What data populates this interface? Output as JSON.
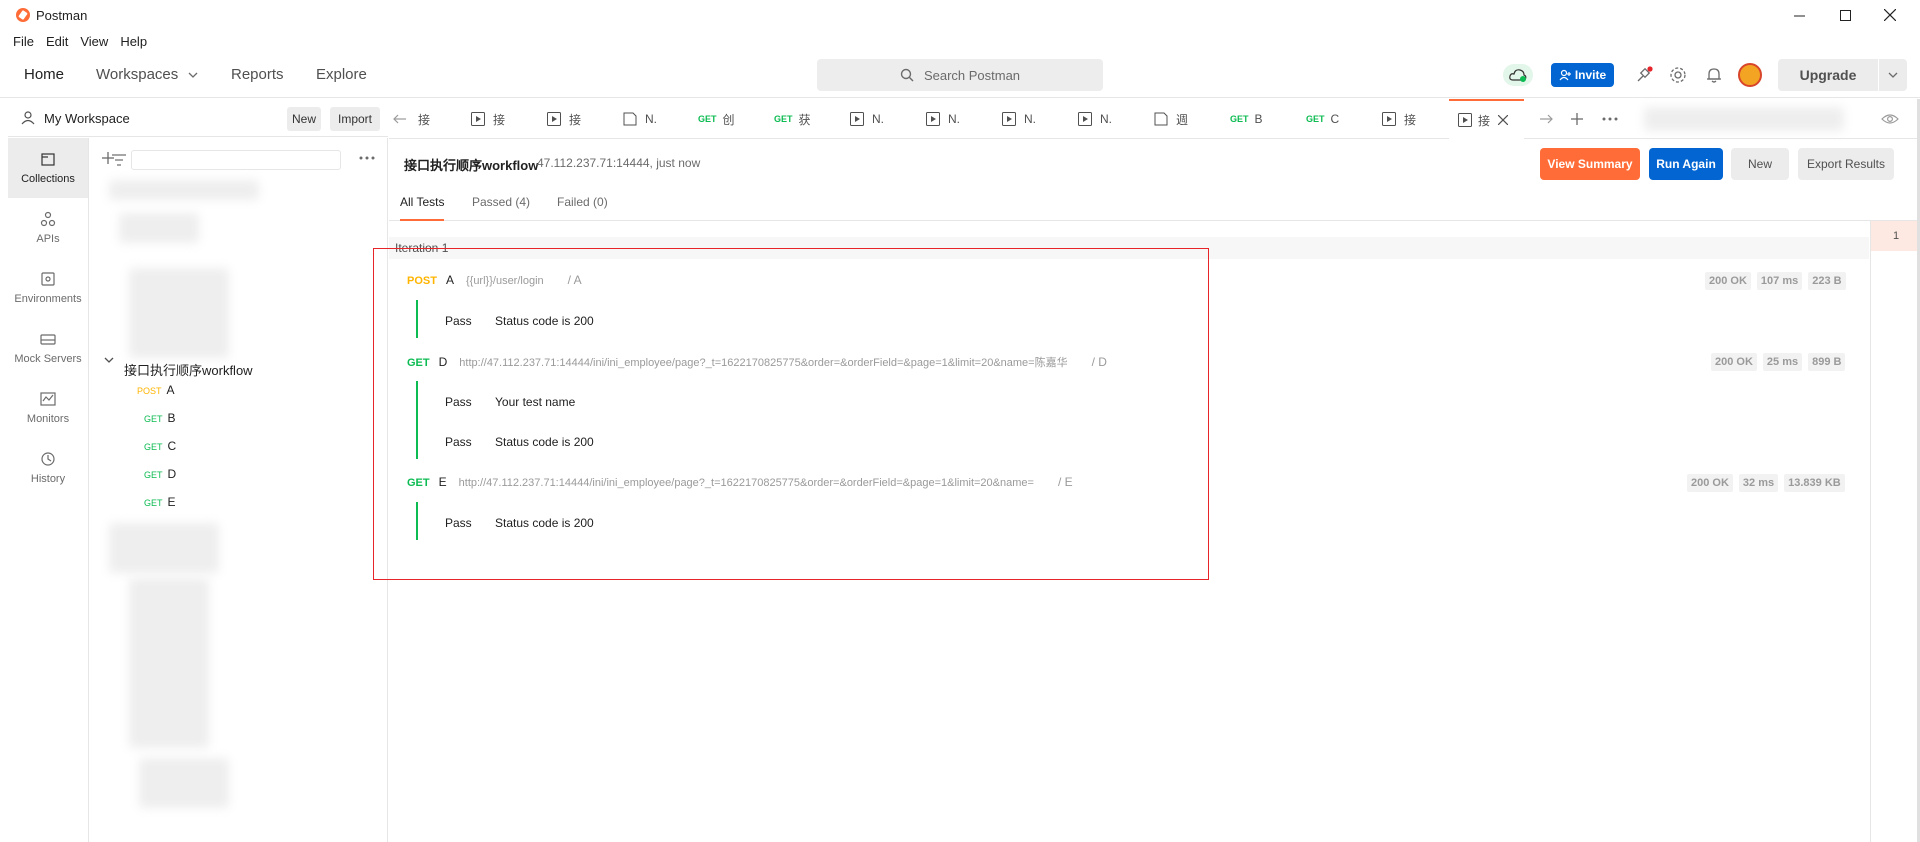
{
  "window": {
    "title": "Postman"
  },
  "menu": [
    "File",
    "Edit",
    "View",
    "Help"
  ],
  "header": {
    "nav": {
      "home": "Home",
      "workspaces": "Workspaces",
      "reports": "Reports",
      "explore": "Explore"
    },
    "search_placeholder": "Search Postman",
    "invite": "Invite",
    "upgrade": "Upgrade"
  },
  "workspace": {
    "name": "My Workspace",
    "new_label": "New",
    "import_label": "Import"
  },
  "rail": [
    {
      "label": "Collections",
      "icon": "collections-icon"
    },
    {
      "label": "APIs",
      "icon": "apis-icon"
    },
    {
      "label": "Environments",
      "icon": "environments-icon"
    },
    {
      "label": "Mock Servers",
      "icon": "mock-servers-icon"
    },
    {
      "label": "Monitors",
      "icon": "monitors-icon"
    },
    {
      "label": "History",
      "icon": "history-icon"
    }
  ],
  "collection": {
    "name": "接口执行顺序workflow",
    "requests": [
      {
        "method": "POST",
        "name": "A"
      },
      {
        "method": "GET",
        "name": "B"
      },
      {
        "method": "GET",
        "name": "C"
      },
      {
        "method": "GET",
        "name": "D"
      },
      {
        "method": "GET",
        "name": "E"
      }
    ]
  },
  "tabs": [
    {
      "method": "",
      "label": "接"
    },
    {
      "method": "",
      "label": "接"
    },
    {
      "method": "",
      "label": "接"
    },
    {
      "method": "",
      "label": "N."
    },
    {
      "method": "GET",
      "label": "创"
    },
    {
      "method": "GET",
      "label": "获"
    },
    {
      "method": "",
      "label": "N."
    },
    {
      "method": "",
      "label": "N."
    },
    {
      "method": "",
      "label": "N."
    },
    {
      "method": "",
      "label": "N."
    },
    {
      "method": "",
      "label": "週"
    },
    {
      "method": "GET",
      "label": "B"
    },
    {
      "method": "GET",
      "label": "C"
    },
    {
      "method": "",
      "label": "接"
    },
    {
      "method": "",
      "label": "接"
    }
  ],
  "runner": {
    "title": "接口执行顺序workflow",
    "subtitle": "47.112.237.71:14444, just now",
    "buttons": {
      "view_summary": "View Summary",
      "run_again": "Run Again",
      "new": "New",
      "export": "Export Results"
    },
    "subtabs": {
      "all": "All Tests",
      "passed": "Passed (4)",
      "failed": "Failed (0)"
    },
    "iteration_label": "Iteration 1",
    "iteration_number": "1",
    "results": [
      {
        "method": "POST",
        "name": "A",
        "url": "{{url}}/user/login",
        "path": "/ A",
        "status": "200 OK",
        "time": "107 ms",
        "size": "223 B",
        "tests": [
          {
            "result": "Pass",
            "name": "Status code is 200"
          }
        ]
      },
      {
        "method": "GET",
        "name": "D",
        "url": "http://47.112.237.71:14444/ini/ini_employee/page?_t=1622170825775&order=&orderField=&page=1&limit=20&name=陈嘉华",
        "path": "/ D",
        "status": "200 OK",
        "time": "25 ms",
        "size": "899 B",
        "tests": [
          {
            "result": "Pass",
            "name": "Your test name"
          },
          {
            "result": "Pass",
            "name": "Status code is 200"
          }
        ]
      },
      {
        "method": "GET",
        "name": "E",
        "url": "http://47.112.237.71:14444/ini/ini_employee/page?_t=1622170825775&order=&orderField=&page=1&limit=20&name=",
        "path": "/ E",
        "status": "200 OK",
        "time": "32 ms",
        "size": "13.839 KB",
        "tests": [
          {
            "result": "Pass",
            "name": "Status code is 200"
          }
        ]
      }
    ]
  },
  "colors": {
    "post": "#ffb400",
    "get": "#0cbb52",
    "accent": "#ff6c37",
    "primary": "#0265d2"
  }
}
